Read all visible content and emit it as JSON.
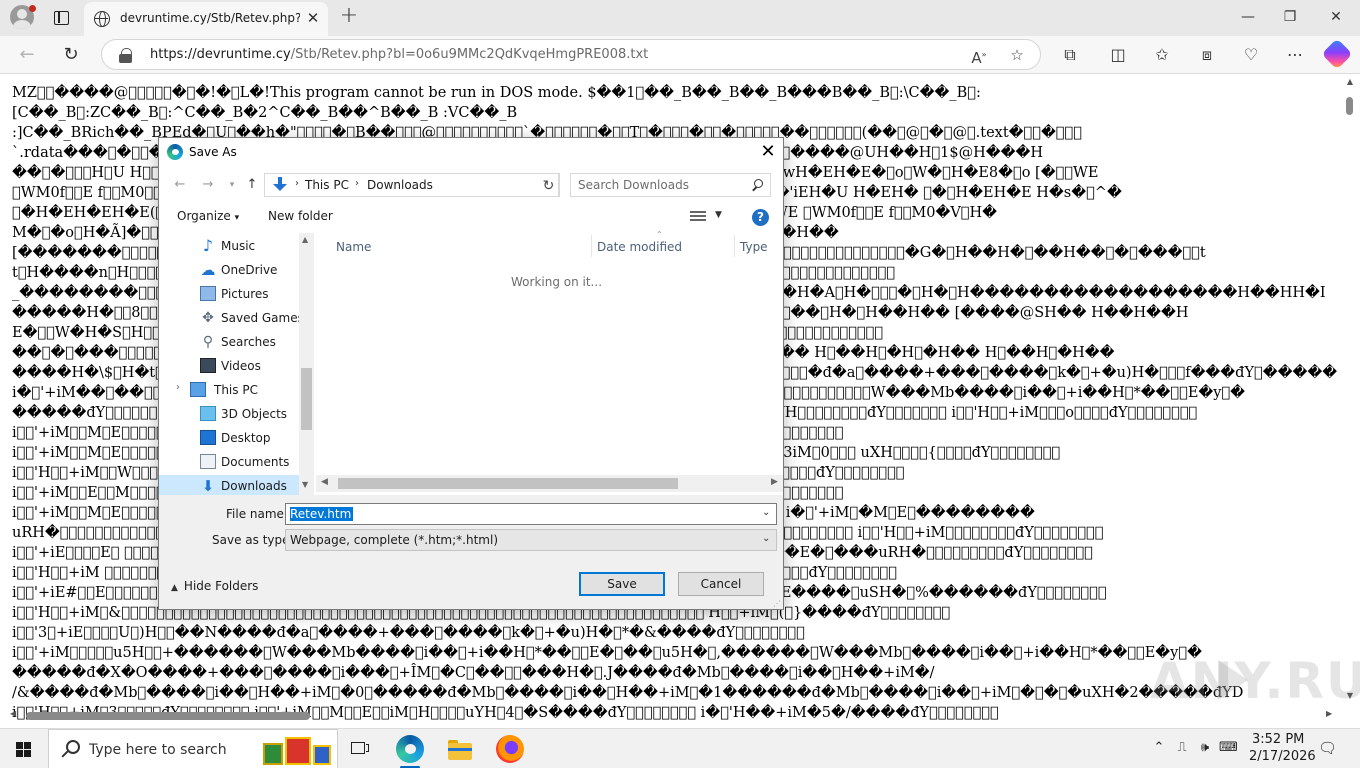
{
  "browser": {
    "tab_title": "devruntime.cy/Stb/Retev.php?bl=",
    "url_host": "https://devruntime.cy",
    "url_path": "/Stb/Retev.php?bl=0o6u9MMc2QdKvqeHmgPRE008.txt"
  },
  "page_text": [
    "MZ\u0000\u0000����@\u0000\u0000\u0000\u0000\u0000�\u0000�!�\u0000L�!This program cannot be run in DOS mode. $��1\u0000��_B��_B��_B���B��_B\u0000:\\C��_B\u0000:",
    "[C��_B\u0000:ZC��_B\u0000:^C��_B�2^C��_B��^B��_B :VC��_B",
    ":]C��_BRich��_BPEd�\u0000U\u0000��h�\"\u0000\u0000\u0000\u0000�\u0000B��\u0000\u0000\u0000@\u0000\u0000\u0000\u0000\u0000\u0000\u0000\u0000\u0000\u0000`�\u0000\u0000\u0000\u0000\u0000\u0000�\u0000\u0000T\u0000�\u0000\u0000\u0000�\u0000\u0000�\u0000\u0000\u0000\u0000\u0000��\u0000\u0000\u0000\u0000\u0000\u0000(��\u0000@\u0000�\u0000@\u0000.text�\u0000\u0000�\u0000\u0000\u0000",
    "`.rdata���\u0000�\u0000\u0000�\u0000\u0000\u0000\u0000\u0000\u0000\u0000\u0000\u0000\u0000\u0000\u0000\u0000\u0000\u0000\u0000\u0000\u0000\u0000\u0000\u0000\u0000\u0000\u0000\u0000\u0000\u0000\u0000\u0000\u0000\u0000\u0000\u0000\u0000\u0000\u0000\u0000\u0000\u0000\u0000\u0000\u0000\u0000\u0000\u0000\u0000\u0000\u0000\u0000\u0000\u0000\u0000\u0000\u0000\u0000��H� ��\u0000��p\u0000����@UH��H\u00001$@H���H",
    "��\u0000�\u0000\u0000\u0000H\u0000U H\u0000\u0000\u0000\u0000\u0000\u0000\u0000\u0000\u0000\u0000\u0000\u0000\u0000\u0000\u0000\u0000\u0000\u0000\u0000\u0000\u0000\u0000\u0000\u0000\u0000\u0000\u0000\u0000\u0000\u0000\u0000\u0000\u0000\u0000\u0000\u0000\u0000\u0000\u0000\u0000\u0000\u0000\u0000\u0000\u0000\u0000\u0000\u0000\u0000\u0000\u0000\u0000\u0000\u0000\u0000H�E0H��\u0000^4�w�wH�EH�E�\u0000o\u0000W�\u0000H�E8�\u0000o [�\u0000\u0000WE",
    "\u0000WM0f\u0000\u0000E f\u0000\u0000M0\u0000\u0000\u0000\u0000\u0000\u0000\u0000\u0000\u0000\u0000\u0000\u0000\u0000\u0000\u0000\u0000\u0000\u0000\u0000\u0000\u0000\u0000\u0000\u0000\u0000\u0000\u0000\u0000\u0000\u0000\u0000\u0000\u0000\u0000\u0000\u0000\u0000\u0000\u0000\u0000\u0000\u0000\u0000\u0000\u0000\u0000\u0000\u0000\u0000\u0000\u0000\u0000\u0000\u0000\u0000\u0000\u0000\u0000���H�M��\u0000�'iEH�U H�EH� \u0000�\u0000H�EH�E H�s�\u0000^�",
    "\u0000�H�EH�EH�E(\u0000\u0000\u0000\u0000\u0000\u0000\u0000\u0000\u0000\u0000\u0000\u0000\u0000\u0000\u0000\u0000\u0000\u0000\u0000\u0000\u0000\u0000\u0000\u0000\u0000\u0000\u0000\u0000\u0000\u0000\u0000\u0000\u0000\u0000\u0000\u0000\u0000\u0000\u0000\u0000\u0000\u0000\u0000\u0000\u0000\u0000\u0000\u0000\u0000\u0000\u0000\u0000\u0000\u0000\u0000\u0000\u0000\u0000\u0000\u0000\u0000\u0000\u0000\u0000o ��\u0000\u0000WE \u0000WM0f\u0000\u0000E f\u0000\u0000M0�V\u0000H�",
    "M�\u0000�o\u0000H�Ã]�\u0000\u0000\u0000\u0000\u0000\u0000\u0000\u0000\u0000\u0000\u0000\u0000\u0000\u0000\u0000\u0000\u0000\u0000\u0000\u0000\u0000\u0000\u0000\u0000\u0000\u0000\u0000\u0000\u0000\u0000\u0000\u0000\u0000\u0000\u0000\u0000\u0000\u0000\u0000\u0000\u0000\u0000\u0000\u0000\u0000\u0000\u0000\u0000\u0000\u0000\u0000\u0000\u0000\u0000\u0000\u0000\u0000\u0000\u0000\u0000\u0000\u0000\u0000\u0000\u0000\u0000�\u0000��H�H��",
    "[�������\u0000\u0000\u0000\u0000\u0000\u0000\u0000\u0000\u0000\u0000\u0000\u0000\u0000\u0000\u0000\u0000\u0000\u0000\u0000\u0000\u0000\u0000\u0000\u0000\u0000\u0000\u0000\u0000\u0000\u0000\u0000\u0000\u0000\u0000\u0000\u0000\u0000\u0000\u0000\u0000\u0000\u0000\u0000\u0000\u0000\u0000\u0000\u0000\u0000\u0000\u0000\u0000\u0000\u0000\u0000\u0000\u0000\u0000\u0000\u0000\u0000\u0000\u0000\u0000\u0000\u0000\u0000\u0000\u0000\u0000\u0000\u0000\u0000\u0000\u0000\u0000\u0000\u0000\u0000\u0000\u0000\u0000\u0000\u0000\u0000\u0000\u0000\u0000\u0000\u0000�G�\u0000H��H�\u0000��H��\u0000�\u0000���\u0000\u0000t",
    "t\u0000H����n\u0000H\u0000\u0000\u0000\u0000\u0000\u0000\u0000\u0000\u0000\u0000\u0000\u0000\u0000\u0000\u0000\u0000\u0000\u0000\u0000\u0000\u0000\u0000\u0000\u0000\u0000\u0000\u0000\u0000\u0000\u0000\u0000\u0000\u0000\u0000\u0000\u0000\u0000\u0000\u0000\u0000\u0000\u0000\u0000\u0000\u0000\u0000\u0000\u0000\u0000\u0000\u0000\u0000\u0000\u0000\u0000\u0000\u0000\u0000\u0000\u0000\u0000\u0000\u0000\u0000\u0000\u0000\u0000\u0000\u0000\u0000\u0000\u0000\u0000\u0000\u0000\u0000\u0000\u0000\u0000\u0000\u0000\u0000\u0000\u0000\u0000\u0000\u0000\u0000",
    "_��������\u0000\u0000\u0000\u0000\u0000\u0000\u0000\u0000\u0000\u0000\u0000\u0000\u0000\u0000\u0000\u0000\u0000\u0000\u0000\u0000\u0000\u0000\u0000\u0000\u0000\u0000\u0000\u0000\u0000\u0000\u0000\u0000\u0000\u0000\u0000\u0000\u0000\u0000\u0000\u0000\u0000\u0000\u0000\u0000\u0000\u0000\u0000\u0000\u0000\u0000\u0000\u0000\u0000\u0000\u0000\u0000\u0000\u0000\u0000\u0000\u0000\u0000\u0000\u0000\u0000\u0000\u0000\u0000\u0000\u0000\u0000\u0000\u0000\u0000�H�A\u0000H�\u0000\u0000\u0000�\u0000H�\u0000H������������������H��HH�I",
    "�����H�\u0000\u00008\u0000\u0000\u0000\u0000\u0000\u0000\u0000\u0000\u0000\u0000\u0000\u0000\u0000\u0000\u0000\u0000\u0000\u0000\u0000\u0000\u0000\u0000\u0000\u0000\u0000\u0000\u0000\u0000\u0000\u0000\u0000\u0000\u0000\u0000\u0000\u0000\u0000\u0000\u0000\u0000\u0000\u0000\u0000\u0000\u0000\u0000\u0000\u0000\u0000\u0000\u0000\u0000\u0000\u0000\u0000\u0000\u0000\u0000\u0000\u0000\u0000\u0000\u0000\u0000\u0000\u0000\u0000\u0000\u0000\u0000\u0000\u0000�\u0000��\u0000H�\u0000H��H�� [����@SH�� H��H��H",
    "E�\u0000\u0000W�H�S\u0000H\u0000\u0000\u0000\u0000\u0000\u0000\u0000\u0000\u0000\u0000\u0000\u0000\u0000\u0000\u0000\u0000\u0000\u0000\u0000\u0000\u0000\u0000\u0000\u0000\u0000\u0000\u0000\u0000\u0000\u0000\u0000\u0000\u0000\u0000\u0000\u0000\u0000\u0000\u0000\u0000\u0000\u0000\u0000\u0000\u0000\u0000\u0000\u0000\u0000\u0000\u0000\u0000\u0000\u0000\u0000\u0000\u0000\u0000\u0000\u0000\u0000\u0000\u0000\u0000\u0000\u0000\u0000\u0000\u0000\u0000\u0000\u0000\u0000\u0000\u0000\u0000\u0000\u0000\u0000\u0000\u0000\u0000\u0000\u0000\u0000",
    "��\u0000�\u0000���\u0000\u0000\u0000\u0000\u0000\u0000\u0000\u0000\u0000\u0000\u0000\u0000\u0000\u0000\u0000\u0000\u0000\u0000\u0000\u0000\u0000\u0000\u0000\u0000\u0000\u0000\u0000\u0000\u0000\u0000\u0000\u0000\u0000\u0000\u0000\u0000\u0000\u0000\u0000\u0000\u0000\u0000\u0000\u0000\u0000\u0000\u0000\u0000\u0000\u0000\u0000\u0000\u0000\u0000\u0000\u0000\u0000\u0000\u0000\u0000\u0000\u0000\u0000\u0000\u0000\u0000\u0000\u0000\u0000\u0000\u0000\u0000\u0000\u0000\u0000\u0000�� H\u0000��H\u0000�H\u0000�H�� H\u0000��H\u0000�H��",
    "����H�\\$\u0000H�t\u0000\u0000\u0000\u0000\u0000\u0000\u0000\u0000\u0000\u0000\u0000\u0000\u0000\u0000\u0000\u0000\u0000\u0000\u0000\u0000\u0000\u0000\u0000\u0000\u0000\u0000\u0000\u0000\u0000\u0000\u0000\u0000\u0000\u0000\u0000\u0000\u0000\u0000\u0000\u0000\u0000\u0000\u0000\u0000\u0000\u0000\u0000\u0000\u0000\u0000\u0000\u0000\u0000\u0000\u0000\u0000\u0000\u0000\u0000\u0000\u0000\u0000\u0000\u0000\u0000\u0000\u0000\u0000\u0000\u0000\u0000\u0000\u0000\u0000\u0000�đ�a\u0000����+���\u0000����\u0000k�\u0000+�u)H�\u0000\u0000\u0000f���đY\u0000�����",
    "i�\u0000'+iM��\u0000��\u0000\u0000\u0000\u0000\u0000\u0000\u0000\u0000\u0000\u0000\u0000\u0000\u0000\u0000\u0000\u0000\u0000\u0000\u0000\u0000\u0000\u0000\u0000\u0000\u0000\u0000\u0000\u0000\u0000\u0000\u0000\u0000\u0000\u0000\u0000\u0000\u0000\u0000\u0000\u0000\u0000\u0000\u0000\u0000\u0000\u0000\u0000\u0000\u0000\u0000\u0000\u0000\u0000\u0000\u0000\u0000\u0000\u0000\u0000\u0000\u0000\u0000\u0000\u0000\u0000\u0000\u0000\u0000\u0000\u0000\u00005H\u0000\u0000\u0000\u0000\u0000\u0000\u0000\u0000\u0000\u0000W���Mb����\u0000i��\u0000+i��H\u0000*��\u0000\u0000E�y\u0000�",
    "�����đY\u0000\u0000\u0000\u0000\u0000\u0000\u0000\u0000\u0000\u0000\u0000\u0000\u0000\u0000\u0000\u0000\u0000\u0000\u0000\u0000\u0000\u0000\u0000\u0000\u0000\u0000\u0000\u0000\u0000\u0000\u0000\u0000\u0000\u0000\u0000\u0000\u0000\u0000\u0000\u0000\u0000\u0000\u0000\u0000\u0000\u0000\u0000\u0000\u0000\u0000\u0000\u0000\u0000\u0000\u0000\u0000\u0000\u0000\u0000\u0000\u0000\u0000\u0000\u0000\u0000\u0000\u0000\u0000\u0000\u0000\u0000\u0000\u0000\u0000\u0000\u0000\u0000YH\u0000\u0000\u0000\u0000\u0000\u0000\u0000\u0000đY\u0000\u0000\u0000\u0000\u0000\u0000\u0000 i\u0000\u0000'H\u0000\u0000+iM\u0000\u0000\u0000o\u0000\u0000\u0000\u0000đY\u0000\u0000\u0000\u0000\u0000\u0000\u0000\u0000",
    "i\u0000\u0000'+iM\u0000\u0000M\u0000E\u0000\u0000\u0000\u0000\u0000\u0000\u0000\u0000\u0000\u0000\u0000\u0000\u0000\u0000\u0000\u0000\u0000\u0000\u0000\u0000\u0000\u0000\u0000\u0000\u0000\u0000\u0000\u0000\u0000\u0000\u0000\u0000\u0000\u0000\u0000\u0000\u0000\u0000\u0000\u0000\u0000\u0000\u0000\u0000\u0000\u0000\u0000\u0000\u0000\u0000\u0000\u0000\u0000\u0000\u0000\u0000\u0000\u0000\u0000\u0000\u0000\u0000\u0000\u0000\u0000\u0000\u0000\u0000\u0000\u0000\u0000\u0000\u0000\u0000\u0000\u0000\u0000\u0000\u0000\u0000\u0000\u0000\u0000",
    "i\u0000\u0000'+iM\u0000\u0000M\u0000E\u0000\u0000\u0000\u0000\u0000\u0000\u0000\u0000\u0000\u0000\u0000\u0000\u0000\u0000\u0000\u0000\u0000\u0000\u0000\u0000\u0000\u0000\u0000\u0000\u0000\u0000\u0000\u0000\u0000\u0000\u0000\u0000\u0000\u0000\u0000\u0000\u0000\u0000\u0000\u0000\u0000\u0000\u0000\u0000\u0000\u0000\u0000\u0000\u0000\u0000\u0000\u0000\u0000\u0000\u0000\u0000\u0000\u0000\u0000\u0000\u0000 i\u0000\u0000'+iM\u0000\u0000M\u0000\u0000E\u00003iM\u00000\u0000\u0000\u0000 uXH\u0000\u0000\u0000\u0000{\u0000\u0000\u0000\u0000đY\u0000\u0000\u0000\u0000\u0000\u0000\u0000\u0000",
    "i\u0000\u0000'H\u0000\u0000+iM\u0000\u0000W\u0000\u0000\u0000\u0000\u0000\u0000\u0000\u0000\u0000\u0000\u0000\u0000\u0000\u0000\u0000\u0000\u0000\u0000\u0000\u0000\u0000\u0000\u0000\u0000\u0000\u0000\u0000\u0000\u0000\u0000\u0000\u0000\u0000\u0000\u0000\u0000\u0000\u0000\u0000\u0000\u0000\u0000\u0000\u0000\u0000\u0000\u0000\u0000\u0000\u0000\u0000\u0000\u0000\u0000\u0000\u0000\u0000\u0000\u0000\u0000 i\u0000\u0000'H\u0000\u0000+iM\u0000\u0000\u0000\u0000\u0000\u0000\u0000\u0000đY\u0000\u0000\u0000\u0000\u0000\u0000\u0000\u0000",
    "i\u0000\u0000'+iM\u0000\u0000E\u0000\u0000M\u0000\u0000\u0000\u0000\u0000\u0000\u0000\u0000\u0000\u0000\u0000\u0000\u0000\u0000\u0000\u0000\u0000\u0000\u0000\u0000\u0000\u0000\u0000\u0000\u0000\u0000\u0000\u0000\u0000\u0000\u0000\u0000\u0000\u0000\u0000\u0000\u0000\u0000\u0000\u0000\u0000\u0000\u0000\u0000\u0000\u0000\u0000\u0000\u0000\u0000\u0000\u0000\u0000\u0000\u0000\u0000\u0000\u0000\u0000\u0000\u0000\u0000\u0000\u0000\u0000\u0000\u0000\u0000\u0000\u0000\u0000\u0000\u0000\u0000\u0000\u0000\u0000\u0000\u0000\u0000\u0000\u0000",
    "i\u0000\u0000'+iM\u0000\u0000M\u0000E\u0000\u0000\u0000\u0000\u0000\u0000\u0000\u0000\u0000\u0000\u0000\u0000\u0000\u0000\u0000\u0000\u0000\u0000\u0000\u0000\u0000\u0000\u0000\u0000\u0000\u0000\u0000\u0000\u0000\u0000\u0000\u0000\u0000\u0000\u0000\u0000\u0000\u0000\u0000\u0000\u0000\u0000\u0000\u0000\u0000\u0000\u0000\u0000\u0000\u0000\u0000\u0000\u0000\u0000\u0000\u0000\u0000\u0000\u0000���đY\u0000����� i�\u0000'+iM\u0000�M\u0000E\u0000��������",
    "uRH�\u0000\u0000\u0000\u0000\u0000\u0000\u0000\u0000\u0000\u0000\u0000\u0000\u0000\u0000\u0000\u0000\u0000\u0000\u0000\u0000\u0000\u0000\u0000\u0000\u0000\u0000\u0000\u0000\u0000\u0000\u0000\u0000\u0000\u0000\u0000\u0000\u0000\u0000\u0000\u0000\u0000\u0000\u0000\u0000\u0000\u0000\u0000\u0000\u0000\u0000\u0000\u0000\u0000\u0000\u0000\u0000\u0000\u0000\u0000\u0000\u0000\u0000\u0000\u0000\u0000\u0000\u0000\u0000\u0000\u0000\u0000\u0000\u0000\u0000\u0000\u0000\u0000\u0000\u0000\u0000\u0000đY\u0000\u0000\u0000\u0000\u0000\u0000\u0000\u0000 i\u0000\u0000'H\u0000\u0000+iM\u0000\u0000\u0000\u0000\u0000\u0000\u0000\u0000đY\u0000\u0000\u0000\u0000\u0000\u0000\u0000\u0000",
    "i\u0000\u0000'+iE\u0000\u0000\u0000\u0000E\u0000 \u0000\u0000\u0000\u0000\u0000\u0000\u0000\u0000\u0000\u0000\u0000\u0000\u0000\u0000\u0000\u0000\u0000\u0000\u0000\u0000\u0000\u0000\u0000\u0000\u0000\u0000\u0000\u0000\u0000\u0000\u0000\u0000\u0000\u0000\u0000\u0000\u0000\u0000\u0000\u0000\u0000\u0000\u0000\u0000\u0000\u0000\u0000\u0000\u0000\u0000\u0000\u0000\u0000\u0000\u0000\u0000\u0000\u0000\u0000���� i�\u0000'+iE\u0000��E�\u0000���uRH�\u0000\u0000\u0000\u0000\u0000\u0000\u0000\u0000\u0000đY\u0000\u0000\u0000\u0000\u0000\u0000\u0000\u0000",
    "i\u0000\u0000'H\u0000\u0000+iM \u0000\u0000\u0000\u0000\u0000\u0000\u0000\u0000\u0000\u0000\u0000\u0000\u0000\u0000\u0000\u0000\u0000\u0000\u0000\u0000\u0000\u0000\u0000\u0000\u0000\u0000\u0000\u0000\u0000\u0000\u0000\u0000\u0000\u0000\u0000\u0000\u0000\u0000\u0000\u0000\u0000\u0000\u0000\u0000\u0000\u0000\u0000\u0000\u0000\u0000\u0000\u0000\u0000\u0000\u0000\u0000\u0000\u0000\u0000\u0000\u0000\u0000\u0000\u0000\u0000\u0000\u0000 i\u0000\u0000'+iM\u0000\"\u0000\u0000\u0000\u0000\u0000đY\u0000\u0000\u0000\u0000\u0000\u0000\u0000\u0000",
    "i\u0000\u0000'+iE#\u0000\u0000E\u0000\u0000\u0000\u0000\u0000\u0000\u0000\u0000\u0000\u0000\u0000\u0000\u0000\u0000\u0000\u0000\u0000\u0000\u0000\u0000\u0000\u0000\u0000\u0000\u0000\u0000\u0000\u0000\u0000\u0000\u0000\u0000\u0000\u0000\u0000\u0000\u0000\u0000\u0000\u0000\u0000\u0000\u0000\u0000\u0000\u0000\u0000\u0000\u0000\u0000\u0000\u0000\u0000\u0000\u0000\u0000\u0000\u0000\u0000\u0000\u0000\u0000�� i�\u0000'+iE+��E����\u0000uSH�\u0000%������đY\u0000\u0000\u0000\u0000\u0000\u0000\u0000\u0000",
    "i\u0000\u0000'H\u0000\u0000+iM\u0000&\u0000\u0000\u0000\u0000\u0000\u0000\u0000\u0000\u0000\u0000\u0000\u0000\u0000\u0000\u0000\u0000\u0000\u0000\u0000\u0000\u0000\u0000\u0000\u0000\u0000\u0000\u0000\u0000\u0000\u0000\u0000\u0000\u0000\u0000\u0000\u0000\u0000\u0000\u0000\u0000\u0000\u0000\u0000\u0000\u0000\u0000\u0000\u0000\u0000\u0000\u0000\u0000\u0000\u0000\u0000\u0000\u0000\u0000\u0000\u0000\u0000\u0000\u0000\u0000\u0000\u0000\u0000'H\u0000\u0000+iM\u0000(\u0000}����đY\u0000\u0000\u0000\u0000\u0000\u0000\u0000\u0000",
    "i\u0000\u0000'3\u0000+iE\u0000\u0000\u0000\u0000U\u0000)H\u0000\u0000��N����đ�a\u0000����+���\u0000����\u0000k�\u0000+�u)H�\u0000*�&����đY\u0000\u0000\u0000\u0000\u0000\u0000\u0000\u0000",
    "i\u0000\u0000'+iM\u0000\u0000\u0000\u0000\u0000u5H\u0000\u0000+������\u0000W���Mb����\u0000i��\u0000+i��H\u0000*��\u0000\u0000E�\u0000��\u0000u5H�\u0000,������\u0000W���Mb\u0000����\u0000i��\u0000+i��H\u0000*��\u0000\u0000E�y\u0000�",
    "�����đ�X�O����+���\u0000����\u0000i���\u0000+ÎM\u0000�C\u0000��\u0000\u0000���H�\u0000.J����đ�Mb\u0000����\u0000i��\u0000H��+iM�/",
    "/&����đ�Mb\u0000����\u0000i��\u0000H��+iM\u0000�0\u0000�����đ�Mb\u0000����\u0000i��\u0000H��+iM\u0000�1������đ�Mb\u0000����\u0000i��\u0000+iM\u0000�\u0000�\u0000�uXH�2�����đYD",
    "i\u0000\u0000'H\u0000\u0000+iM\u00003\u0000\u0000\u0000\u0000\u0000đY\u0000\u0000\u0000\u0000\u0000\u0000\u0000\u0000 i\u0000\u0000'+iM\u0000\u0000M\u0000\u0000E\u0000\u0000iM\u0000H\u0000\u0000\u0000\u0000uYH\u00004\u0000�S����đY\u0000\u0000\u0000\u0000\u0000\u0000\u0000\u0000 i�\u0000'H��+iM�5�/����đY\u0000\u0000\u0000\u0000\u0000\u0000\u0000\u0000"
  ],
  "watermark": "ANY.RUN",
  "dialog": {
    "title": "Save As",
    "path": [
      "This PC",
      "Downloads"
    ],
    "search_placeholder": "Search Downloads",
    "organize_label": "Organize",
    "new_folder_label": "New folder",
    "help_label": "?",
    "nav_tree": [
      {
        "label": "Music",
        "icon": "music-icon"
      },
      {
        "label": "OneDrive",
        "icon": "cloud-icon"
      },
      {
        "label": "Pictures",
        "icon": "pictures-icon"
      },
      {
        "label": "Saved Games",
        "icon": "saved-games-icon"
      },
      {
        "label": "Searches",
        "icon": "searches-icon"
      },
      {
        "label": "Videos",
        "icon": "videos-icon"
      },
      {
        "label": "This PC",
        "icon": "computer-icon"
      },
      {
        "label": "3D Objects",
        "icon": "3d-objects-icon"
      },
      {
        "label": "Desktop",
        "icon": "desktop-icon"
      },
      {
        "label": "Documents",
        "icon": "documents-icon"
      },
      {
        "label": "Downloads",
        "icon": "downloads-icon",
        "selected": true
      }
    ],
    "columns": [
      "Name",
      "Date modified",
      "Type"
    ],
    "status": "Working on it...",
    "file_name_label": "File name:",
    "file_name_value": "Retev.htm",
    "save_type_label": "Save as type:",
    "save_type_value": "Webpage, complete (*.htm;*.html)",
    "hide_folders_label": "Hide Folders",
    "save_label": "Save",
    "cancel_label": "Cancel"
  },
  "taskbar": {
    "search_placeholder": "Type here to search",
    "time": "3:52 PM",
    "date": "2/17/2026"
  },
  "colors": {
    "accent": "#0078d7",
    "selection": "#cce8ff",
    "taskbar_bg": "#f1f1f1"
  }
}
